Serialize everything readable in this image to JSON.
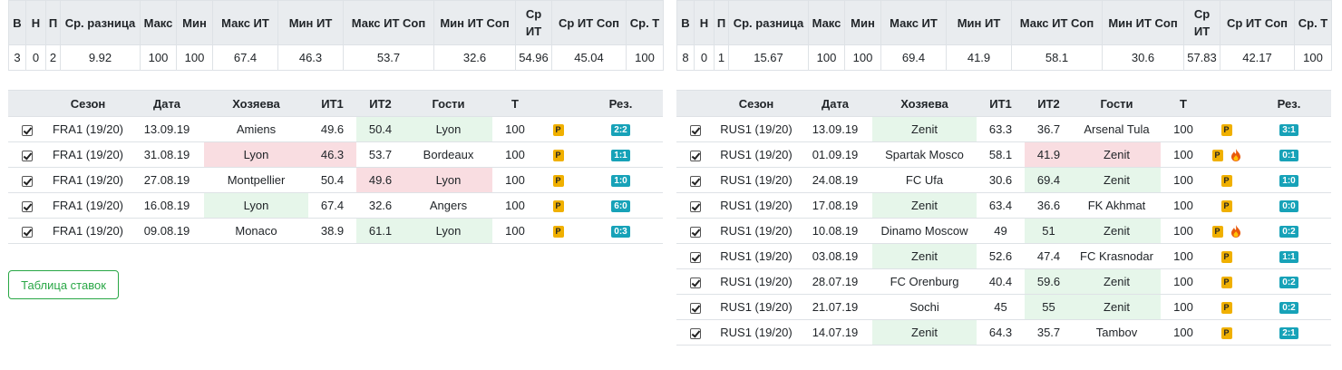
{
  "stat_headers": [
    "В",
    "Н",
    "П",
    "Ср. разница",
    "Макс",
    "Мин",
    "Макс ИТ",
    "Мин ИТ",
    "Макс ИТ Соп",
    "Мин ИТ Соп",
    "Ср ИТ",
    "Ср ИТ Соп",
    "Ср. Т"
  ],
  "match_headers": [
    "",
    "Сезон",
    "Дата",
    "Хозяева",
    "ИТ1",
    "ИТ2",
    "Гости",
    "Т",
    "",
    "Рез."
  ],
  "panels": [
    {
      "stats": [
        "3",
        "0",
        "2",
        "9.92",
        "100",
        "100",
        "67.4",
        "46.3",
        "53.7",
        "32.6",
        "54.96",
        "45.04",
        "100"
      ],
      "matches": [
        {
          "season": "FRA1 (19/20)",
          "date": "13.09.19",
          "home": "Amiens",
          "it1": "49.6",
          "it2": "50.4",
          "away": "Lyon",
          "t": "100",
          "p": "P",
          "score": "2:2",
          "hl": "away-win",
          "fire": false
        },
        {
          "season": "FRA1 (19/20)",
          "date": "31.08.19",
          "home": "Lyon",
          "it1": "46.3",
          "it2": "53.7",
          "away": "Bordeaux",
          "t": "100",
          "p": "P",
          "score": "1:1",
          "hl": "home-lose",
          "fire": false
        },
        {
          "season": "FRA1 (19/20)",
          "date": "27.08.19",
          "home": "Montpellier",
          "it1": "50.4",
          "it2": "49.6",
          "away": "Lyon",
          "t": "100",
          "p": "P",
          "score": "1:0",
          "hl": "away-lose",
          "fire": false
        },
        {
          "season": "FRA1 (19/20)",
          "date": "16.08.19",
          "home": "Lyon",
          "it1": "67.4",
          "it2": "32.6",
          "away": "Angers",
          "t": "100",
          "p": "P",
          "score": "6:0",
          "hl": "home-win",
          "fire": false
        },
        {
          "season": "FRA1 (19/20)",
          "date": "09.08.19",
          "home": "Monaco",
          "it1": "38.9",
          "it2": "61.1",
          "away": "Lyon",
          "t": "100",
          "p": "P",
          "score": "0:3",
          "hl": "away-win",
          "fire": false
        }
      ]
    },
    {
      "stats": [
        "8",
        "0",
        "1",
        "15.67",
        "100",
        "100",
        "69.4",
        "41.9",
        "58.1",
        "30.6",
        "57.83",
        "42.17",
        "100"
      ],
      "matches": [
        {
          "season": "RUS1 (19/20)",
          "date": "13.09.19",
          "home": "Zenit",
          "it1": "63.3",
          "it2": "36.7",
          "away": "Arsenal Tula",
          "t": "100",
          "p": "P",
          "score": "3:1",
          "hl": "home-win",
          "fire": false
        },
        {
          "season": "RUS1 (19/20)",
          "date": "01.09.19",
          "home": "Spartak Mosco",
          "it1": "58.1",
          "it2": "41.9",
          "away": "Zenit",
          "t": "100",
          "p": "P",
          "score": "0:1",
          "hl": "away-lose",
          "fire": true
        },
        {
          "season": "RUS1 (19/20)",
          "date": "24.08.19",
          "home": "FC Ufa",
          "it1": "30.6",
          "it2": "69.4",
          "away": "Zenit",
          "t": "100",
          "p": "P",
          "score": "1:0",
          "hl": "away-win",
          "fire": false
        },
        {
          "season": "RUS1 (19/20)",
          "date": "17.08.19",
          "home": "Zenit",
          "it1": "63.4",
          "it2": "36.6",
          "away": "FK Akhmat",
          "t": "100",
          "p": "P",
          "score": "0:0",
          "hl": "home-win",
          "fire": false
        },
        {
          "season": "RUS1 (19/20)",
          "date": "10.08.19",
          "home": "Dinamo Moscow",
          "it1": "49",
          "it2": "51",
          "away": "Zenit",
          "t": "100",
          "p": "P",
          "score": "0:2",
          "hl": "away-win",
          "fire": true
        },
        {
          "season": "RUS1 (19/20)",
          "date": "03.08.19",
          "home": "Zenit",
          "it1": "52.6",
          "it2": "47.4",
          "away": "FC Krasnodar",
          "t": "100",
          "p": "P",
          "score": "1:1",
          "hl": "home-win",
          "fire": false
        },
        {
          "season": "RUS1 (19/20)",
          "date": "28.07.19",
          "home": "FC Orenburg",
          "it1": "40.4",
          "it2": "59.6",
          "away": "Zenit",
          "t": "100",
          "p": "P",
          "score": "0:2",
          "hl": "away-win",
          "fire": false
        },
        {
          "season": "RUS1 (19/20)",
          "date": "21.07.19",
          "home": "Sochi",
          "it1": "45",
          "it2": "55",
          "away": "Zenit",
          "t": "100",
          "p": "P",
          "score": "0:2",
          "hl": "away-win",
          "fire": false
        },
        {
          "season": "RUS1 (19/20)",
          "date": "14.07.19",
          "home": "Zenit",
          "it1": "64.3",
          "it2": "35.7",
          "away": "Tambov",
          "t": "100",
          "p": "P",
          "score": "2:1",
          "hl": "home-win",
          "fire": false
        }
      ]
    }
  ],
  "bets_button_label": "Таблица ставок",
  "colors": {
    "win": "#e6f6ea",
    "lose": "#f9dde1",
    "score_badge": "#17a2b8",
    "p_badge": "#f0b000",
    "button_outline": "#28a745"
  },
  "icons": {
    "checkbox": "checkbox-checked-icon",
    "p_badge": "p-badge-icon",
    "fire": "fire-icon"
  }
}
